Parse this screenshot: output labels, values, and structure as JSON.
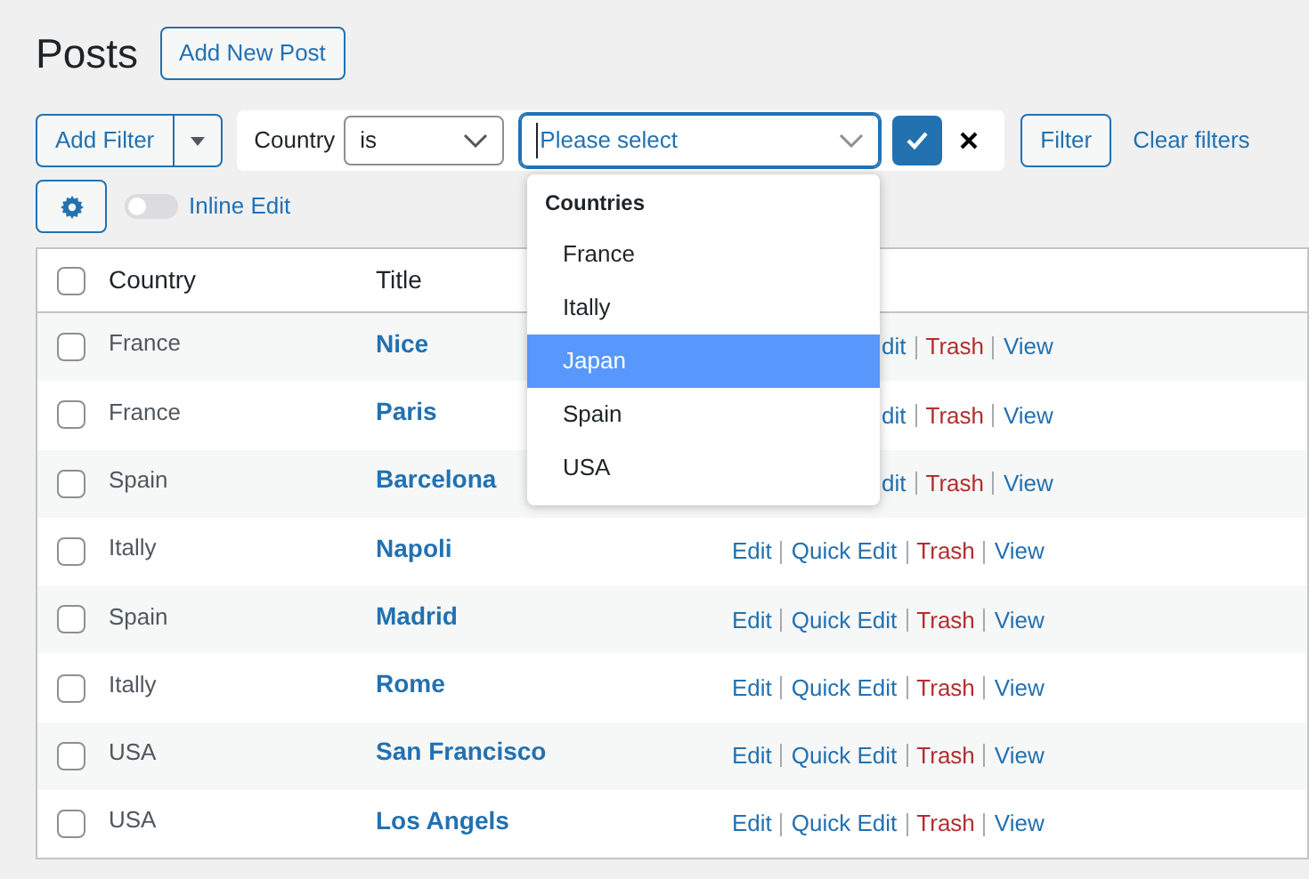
{
  "page_title": "Posts",
  "add_new_button": "Add New Post",
  "filter_bar": {
    "add_filter": "Add Filter",
    "field_label": "Country",
    "operator": "is",
    "value_placeholder": "Please select",
    "filter_button": "Filter",
    "clear_filters": "Clear filters"
  },
  "inline_edit": {
    "label": "Inline Edit",
    "on": false
  },
  "dropdown": {
    "group": "Countries",
    "options": [
      {
        "label": "France",
        "selected": false
      },
      {
        "label": "Itally",
        "selected": false
      },
      {
        "label": "Japan",
        "selected": true
      },
      {
        "label": "Spain",
        "selected": false
      },
      {
        "label": "USA",
        "selected": false
      }
    ]
  },
  "table": {
    "select_all_checked": false,
    "columns": [
      "Country",
      "Title"
    ],
    "rows": [
      {
        "checked": false,
        "country": "France",
        "title": "Nice",
        "actions": [
          {
            "kind": "edit_cut",
            "label": "dit"
          },
          {
            "kind": "trash",
            "label": "Trash"
          },
          {
            "kind": "view",
            "label": "View"
          }
        ]
      },
      {
        "checked": false,
        "country": "France",
        "title": "Paris",
        "actions": [
          {
            "kind": "edit_cut",
            "label": "dit"
          },
          {
            "kind": "trash",
            "label": "Trash"
          },
          {
            "kind": "view",
            "label": "View"
          }
        ]
      },
      {
        "checked": false,
        "country": "Spain",
        "title": "Barcelona",
        "actions": [
          {
            "kind": "edit_cut",
            "label": "dit"
          },
          {
            "kind": "trash",
            "label": "Trash"
          },
          {
            "kind": "view",
            "label": "View"
          }
        ]
      },
      {
        "checked": false,
        "country": "Itally",
        "title": "Napoli",
        "actions": [
          {
            "kind": "edit",
            "label": "Edit"
          },
          {
            "kind": "edit",
            "label": "Quick Edit"
          },
          {
            "kind": "trash",
            "label": "Trash"
          },
          {
            "kind": "view",
            "label": "View"
          }
        ]
      },
      {
        "checked": false,
        "country": "Spain",
        "title": "Madrid",
        "actions": [
          {
            "kind": "edit",
            "label": "Edit"
          },
          {
            "kind": "edit",
            "label": "Quick Edit"
          },
          {
            "kind": "trash",
            "label": "Trash"
          },
          {
            "kind": "view",
            "label": "View"
          }
        ]
      },
      {
        "checked": false,
        "country": "Itally",
        "title": "Rome",
        "actions": [
          {
            "kind": "edit",
            "label": "Edit"
          },
          {
            "kind": "edit",
            "label": "Quick Edit"
          },
          {
            "kind": "trash",
            "label": "Trash"
          },
          {
            "kind": "view",
            "label": "View"
          }
        ]
      },
      {
        "checked": false,
        "country": "USA",
        "title": "San Francisco",
        "actions": [
          {
            "kind": "edit",
            "label": "Edit"
          },
          {
            "kind": "edit",
            "label": "Quick Edit"
          },
          {
            "kind": "trash",
            "label": "Trash"
          },
          {
            "kind": "view",
            "label": "View"
          }
        ]
      },
      {
        "checked": false,
        "country": "USA",
        "title": "Los Angels",
        "actions": [
          {
            "kind": "edit",
            "label": "Edit"
          },
          {
            "kind": "edit",
            "label": "Quick Edit"
          },
          {
            "kind": "trash",
            "label": "Trash"
          },
          {
            "kind": "view",
            "label": "View"
          }
        ]
      }
    ]
  }
}
